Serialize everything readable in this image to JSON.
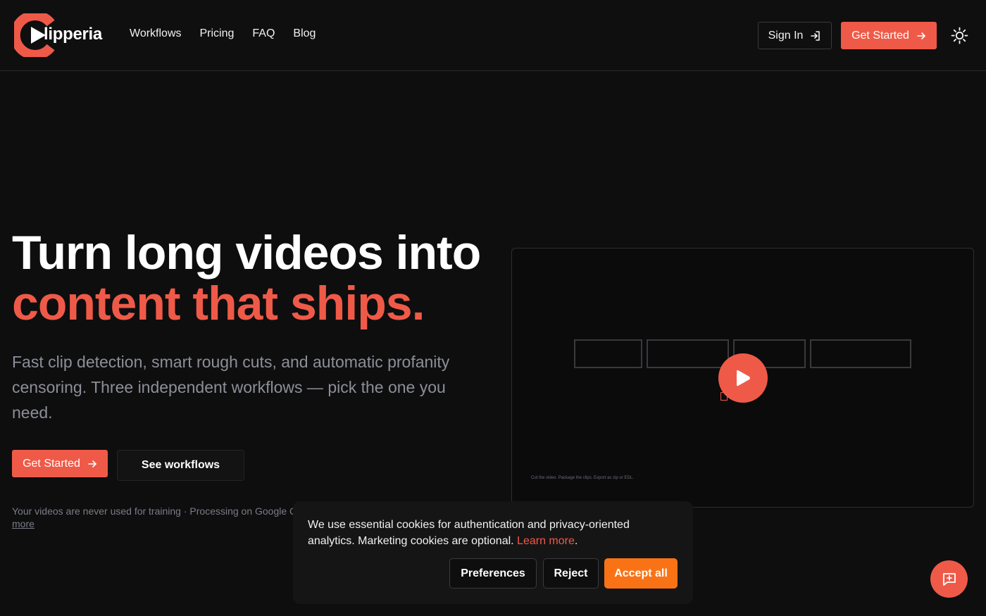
{
  "brand": {
    "name": "lipperia",
    "accent": "#ef5a48",
    "accept_color": "#f97316"
  },
  "nav": {
    "items": [
      "Workflows",
      "Pricing",
      "FAQ",
      "Blog"
    ]
  },
  "header": {
    "signin_label": "Sign In",
    "signin_icon": "login-icon",
    "get_started_label": "Get Started",
    "arrow_icon": "arrow-right-icon",
    "theme_icon": "sun-icon"
  },
  "hero": {
    "title_line1": "Turn long videos into",
    "title_line2": "content that ships.",
    "subtitle": "Fast clip detection, smart rough cuts, and automatic profanity censoring. Three independent workflows — pick the one you need.",
    "cta_primary": "Get Started",
    "cta_secondary": "See workflows",
    "privacy_note": "Your videos are never used for training · Processing on Google C",
    "privacy_more": "more"
  },
  "video": {
    "caption": "Cut the video. Package the clips. Export as zip or EDL.",
    "play_icon": "play-icon"
  },
  "cookie": {
    "text_before": "We use essential cookies for authentication and privacy-oriented analytics. Marketing cookies are optional.",
    "link": "Learn more",
    "text_after": ".",
    "preferences": "Preferences",
    "reject": "Reject",
    "accept": "Accept all"
  },
  "chat": {
    "icon": "chat-plus-icon"
  }
}
